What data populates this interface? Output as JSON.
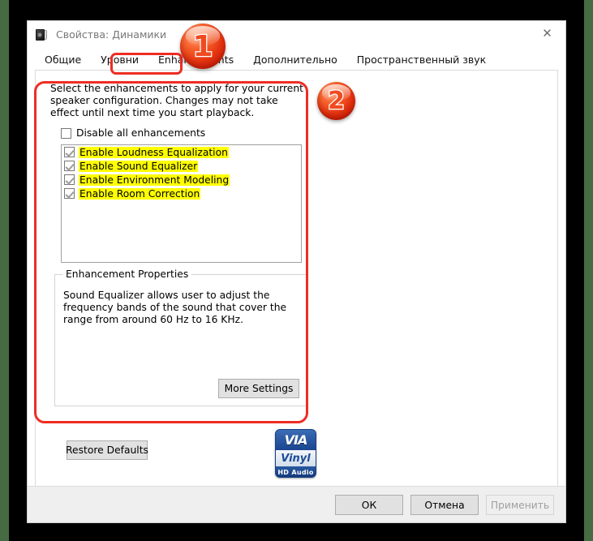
{
  "window": {
    "title": "Свойства: Динамики",
    "icon": "speaker-icon",
    "close_label": "✕"
  },
  "tabs": [
    {
      "label": "Общие",
      "active": false
    },
    {
      "label": "Уровни",
      "active": false
    },
    {
      "label": "Enhancements",
      "active": true
    },
    {
      "label": "Дополнительно",
      "active": false
    },
    {
      "label": "Пространственный звук",
      "active": false
    }
  ],
  "content": {
    "intro": "Select the enhancements to apply for your current speaker configuration. Changes may not take effect until next time you start playback.",
    "disable_all": {
      "label": "Disable all enhancements",
      "checked": false
    },
    "enhancements": [
      {
        "label": "Enable Loudness Equalization",
        "checked": true,
        "highlighted": true
      },
      {
        "label": "Enable Sound Equalizer",
        "checked": true,
        "highlighted": true
      },
      {
        "label": "Enable Environment Modeling",
        "checked": true,
        "highlighted": true
      },
      {
        "label": "Enable Room Correction",
        "checked": true,
        "highlighted": true
      }
    ],
    "properties_group": {
      "title": "Enhancement Properties",
      "description": "Sound Equalizer allows user to adjust the frequency bands of the sound that cover the range from around 60 Hz to 16 KHz."
    },
    "more_settings_label": "More Settings",
    "restore_defaults_label": "Restore Defaults"
  },
  "logo": {
    "mark": "VIA",
    "name": "Vinyl",
    "sub": "HD Audio"
  },
  "dialog_buttons": [
    {
      "label": "ОК",
      "disabled": false
    },
    {
      "label": "Отмена",
      "disabled": false
    },
    {
      "label": "Применить",
      "disabled": true
    }
  ],
  "annotations": {
    "badge_one": "1",
    "badge_two": "2",
    "highlight_color": "#ee2d24",
    "highlight_fill": "#ffff00"
  }
}
